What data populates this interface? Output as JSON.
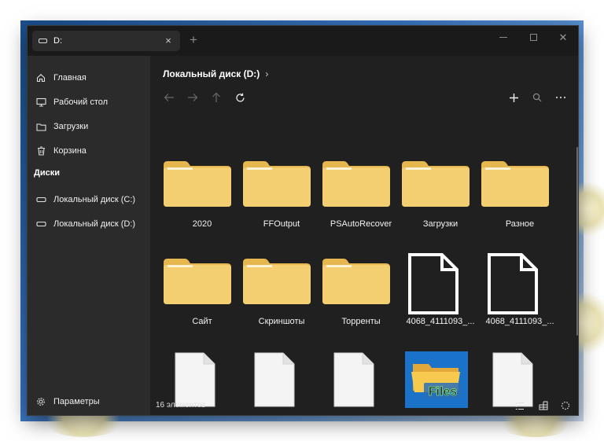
{
  "tab": {
    "title": "D:",
    "close": "×",
    "new": "+"
  },
  "window_controls": {
    "close": "✕"
  },
  "sidebar": {
    "items": [
      {
        "label": "Главная",
        "icon": "home-icon"
      },
      {
        "label": "Рабочий стол",
        "icon": "desktop-icon"
      },
      {
        "label": "Загрузки",
        "icon": "folder-icon"
      },
      {
        "label": "Корзина",
        "icon": "trash-icon"
      }
    ],
    "drives_header": "Диски",
    "drives": [
      {
        "label": "Локальный диск (C:)",
        "icon": "drive-icon"
      },
      {
        "label": "Локальный диск (D:)",
        "icon": "drive-icon"
      }
    ],
    "settings_label": "Параметры"
  },
  "main": {
    "breadcrumb": "Локальный диск (D:)",
    "breadcrumb_sep": "›",
    "items": [
      {
        "label": "2020",
        "type": "folder"
      },
      {
        "label": "FFOutput",
        "type": "folder"
      },
      {
        "label": "PSAutoRecover",
        "type": "folder"
      },
      {
        "label": "Загрузки",
        "type": "folder"
      },
      {
        "label": "Разное",
        "type": "folder"
      },
      {
        "label": "Сайт",
        "type": "folder"
      },
      {
        "label": "Скриншоты",
        "type": "folder"
      },
      {
        "label": "Торренты",
        "type": "folder"
      },
      {
        "label": "4068_4111093_...",
        "type": "file-outline"
      },
      {
        "label": "4068_4111093_...",
        "type": "file-outline"
      },
      {
        "label": "",
        "type": "file-white"
      },
      {
        "label": "",
        "type": "file-white"
      },
      {
        "label": "",
        "type": "file-white"
      },
      {
        "label": "Files",
        "type": "files-app"
      },
      {
        "label": "",
        "type": "file-white"
      }
    ]
  },
  "status": {
    "count_text": "16 элементов"
  },
  "colors": {
    "folder": "#f4cf72",
    "folder_tab": "#e6b64f",
    "accent_blue": "#1a72c9"
  }
}
